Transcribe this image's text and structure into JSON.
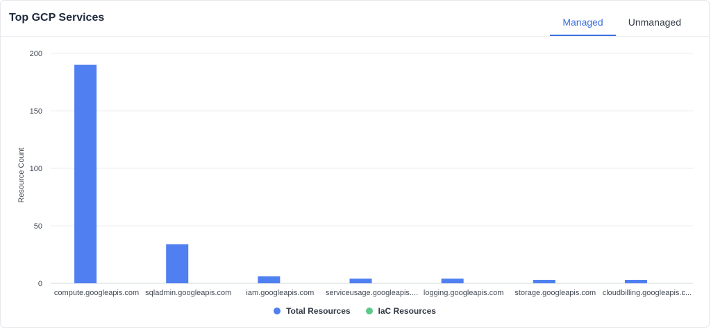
{
  "card": {
    "title": "Top GCP Services"
  },
  "tabs": [
    {
      "label": "Managed",
      "active": true
    },
    {
      "label": "Unmanaged",
      "active": false
    }
  ],
  "colors": {
    "total": "#4f7ff0",
    "iac": "#5cc98a"
  },
  "chart_data": {
    "type": "bar",
    "categories": [
      "compute.googleapis.com",
      "sqladmin.googleapis.com",
      "iam.googleapis.com",
      "serviceusage.googleapis....",
      "logging.googleapis.com",
      "storage.googleapis.com",
      "cloudbilling.googleapis.c..."
    ],
    "series": [
      {
        "name": "Total Resources",
        "values": [
          190,
          34,
          6,
          4,
          4,
          3,
          3
        ]
      },
      {
        "name": "IaC Resources",
        "values": [
          0,
          0,
          0,
          0,
          0,
          0,
          0
        ]
      }
    ],
    "ylabel": "Resource Count",
    "yticks": [
      0,
      50,
      100,
      150,
      200
    ],
    "ylim": [
      0,
      200
    ],
    "grid": true,
    "legend_position": "bottom-center"
  }
}
